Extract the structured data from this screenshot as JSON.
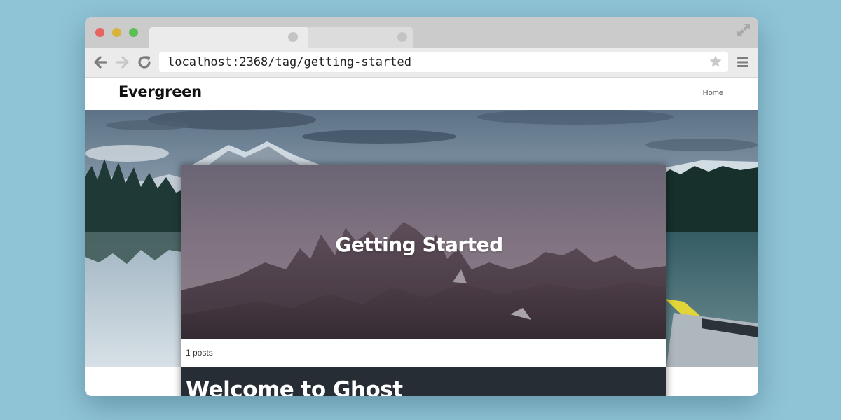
{
  "browser": {
    "url": "localhost:2368/tag/getting-started",
    "icons": {
      "back": "arrow-left-icon",
      "forward": "arrow-right-icon",
      "reload": "reload-icon",
      "bookmark": "star-icon",
      "menu": "hamburger-menu-icon",
      "fullscreen": "expand-icon"
    }
  },
  "site": {
    "title": "Evergreen",
    "nav": [
      {
        "label": "Home"
      }
    ]
  },
  "tag": {
    "name": "Getting Started",
    "post_count": "1 posts"
  },
  "posts": [
    {
      "title": "Welcome to Ghost"
    }
  ],
  "colors": {
    "background": "#8fc3d6",
    "post_card_bg": "#262d35",
    "traffic_red": "#e86460",
    "traffic_yellow": "#d7b33c",
    "traffic_green": "#5bbf54"
  }
}
